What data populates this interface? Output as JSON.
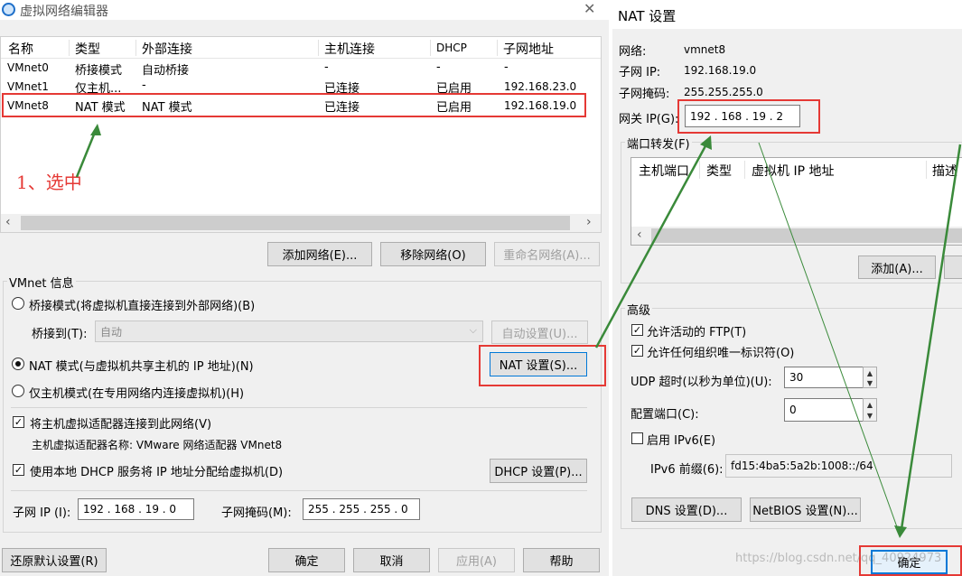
{
  "left": {
    "title": "虚拟网络编辑器",
    "close_glyph": "✕",
    "table": {
      "headers": [
        "名称",
        "类型",
        "外部连接",
        "主机连接",
        "DHCP",
        "子网地址"
      ],
      "rows": [
        [
          "VMnet0",
          "桥接模式",
          "自动桥接",
          "-",
          "-",
          "-"
        ],
        [
          "VMnet1",
          "仅主机...",
          "-",
          "已连接",
          "已启用",
          "192.168.23.0"
        ],
        [
          "VMnet8",
          "NAT 模式",
          "NAT 模式",
          "已连接",
          "已启用",
          "192.168.19.0"
        ]
      ]
    },
    "annotation": "1、选中",
    "buttons": {
      "add": "添加网络(E)...",
      "remove": "移除网络(O)",
      "rename": "重命名网络(A)..."
    },
    "vmnet_info": "VMnet 信息",
    "bridge_mode": "桥接模式(将虚拟机直接连接到外部网络)(B)",
    "bridge_to_label": "桥接到(T):",
    "bridge_to_value": "自动",
    "auto_settings": "自动设置(U)...",
    "nat_mode": "NAT 模式(与虚拟机共享主机的 IP 地址)(N)",
    "nat_settings": "NAT 设置(S)...",
    "host_only": "仅主机模式(在专用网络内连接虚拟机)(H)",
    "connect_adapter": "将主机虚拟适配器连接到此网络(V)",
    "adapter_name": "主机虚拟适配器名称: VMware 网络适配器 VMnet8",
    "use_dhcp": "使用本地 DHCP 服务将 IP 地址分配给虚拟机(D)",
    "dhcp_settings": "DHCP 设置(P)...",
    "subnet_ip_label": "子网 IP (I):",
    "subnet_ip_value": "192 . 168 . 19 . 0",
    "subnet_mask_label": "子网掩码(M):",
    "subnet_mask_value": "255 . 255 . 255 . 0",
    "footer": {
      "restore": "还原默认设置(R)",
      "ok": "确定",
      "cancel": "取消",
      "apply": "应用(A)",
      "help": "帮助"
    }
  },
  "right": {
    "title": "NAT 设置",
    "network_label": "网络:",
    "network_value": "vmnet8",
    "subnet_ip_label": "子网 IP:",
    "subnet_ip_value": "192.168.19.0",
    "subnet_mask_label": "子网掩码:",
    "subnet_mask_value": "255.255.255.0",
    "gateway_label": "网关 IP(G):",
    "gateway_value": "192 . 168 . 19 . 2",
    "port_forward": "端口转发(F)",
    "pf_headers": [
      "主机端口",
      "类型",
      "虚拟机 IP 地址",
      "描述"
    ],
    "add_button": "添加(A)...",
    "advanced": "高级",
    "allow_ftp": "允许活动的 FTP(T)",
    "allow_oid": "允许任何组织唯一标识符(O)",
    "udp_label": "UDP 超时(以秒为单位)(U):",
    "udp_value": "30",
    "config_port_label": "配置端口(C):",
    "config_port_value": "0",
    "enable_ipv6": "启用 IPv6(E)",
    "ipv6_prefix_label": "IPv6 前缀(6):",
    "ipv6_prefix_value": "fd15:4ba5:5a2b:1008::/64",
    "dns_button": "DNS 设置(D)...",
    "netbios_button": "NetBIOS 设置(N)...",
    "ok_button": "确定",
    "watermark": "https://blog.csdn.net/qq_40924973"
  },
  "colors": {
    "annotation_red": "#e53935",
    "arrow_green": "#3a8a3a",
    "window_bg": "#f0f0f0",
    "selected_row": "#ffffff"
  }
}
